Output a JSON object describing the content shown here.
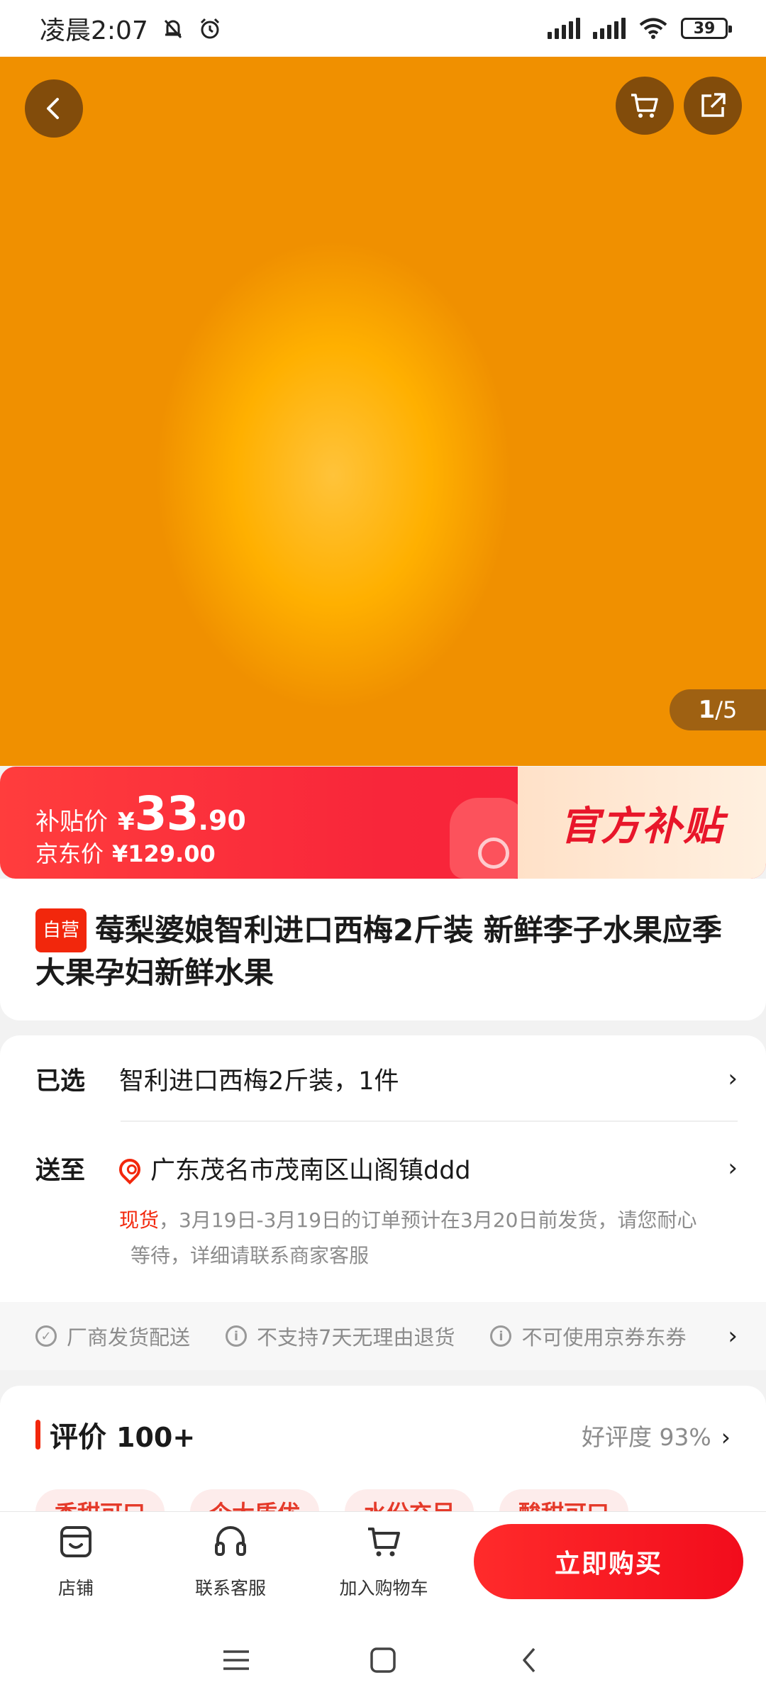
{
  "status_bar": {
    "time": "凌晨2:07",
    "battery": "39"
  },
  "hero": {
    "page_current": "1",
    "page_total": "/5"
  },
  "price": {
    "subsidy_label": "补贴价",
    "currency": "¥",
    "subsidy_int": "33",
    "subsidy_dec": ".90",
    "jd_label": "京东价",
    "jd_price": "¥129.00",
    "badge": "官方补贴"
  },
  "product": {
    "tag": "自营",
    "title": "莓梨婆娘智利进口西梅2斤装 新鲜李子水果应季大果孕妇新鲜水果"
  },
  "options": {
    "selected_label": "已选",
    "selected_value": "智利进口西梅2斤装，1件",
    "ship_label": "送至",
    "address": "广东茂名市茂南区山阁镇ddd",
    "stock_status": "现货",
    "ship_line1": "，3月19日-3月19日的订单预计在3月20日前发货，请您耐心",
    "ship_line2": "等待，详细请联系商家客服"
  },
  "services": [
    {
      "label": "厂商发货配送"
    },
    {
      "label": "不支持7天无理由退货"
    },
    {
      "label": "不可使用京券东券"
    }
  ],
  "reviews": {
    "title": "评价",
    "count": "100+",
    "rating_label": "好评度",
    "rating_value": "93%",
    "chips": [
      "香甜可口",
      "个大质优",
      "水份充足",
      "酸甜可口"
    ]
  },
  "bottom_bar": {
    "shop": "店铺",
    "service": "联系客服",
    "add_cart": "加入购物车",
    "buy_now": "立即购买"
  },
  "colors": {
    "brand_red": "#f2270c",
    "price_banner": "#f8263a"
  }
}
